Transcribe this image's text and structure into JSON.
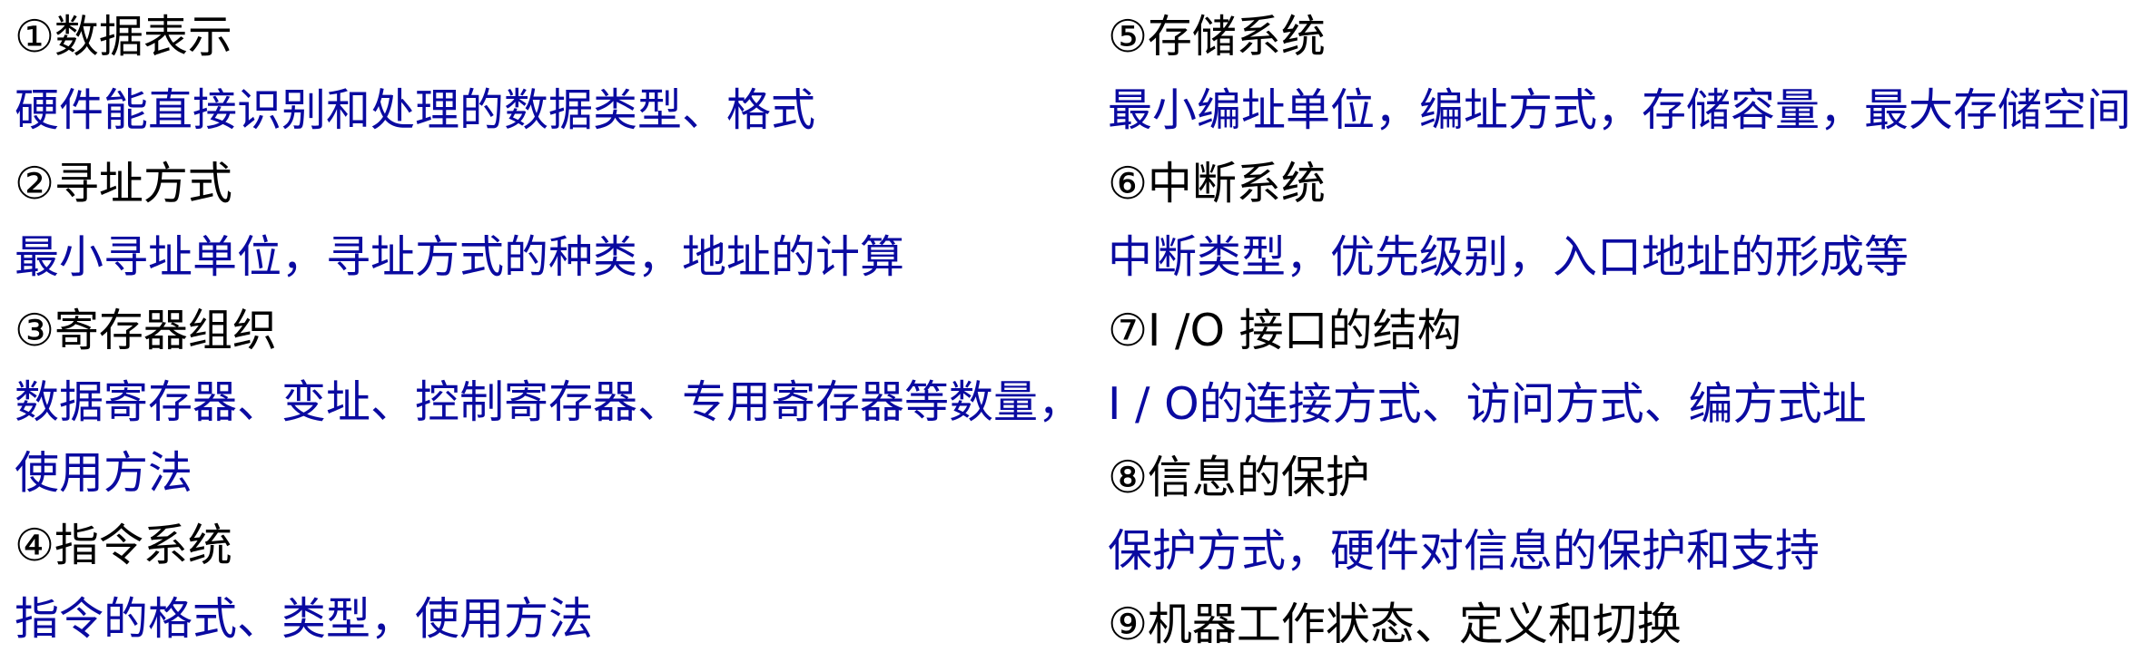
{
  "left": [
    {
      "heading": "①数据表示",
      "desc": "硬件能直接识别和处理的数据类型、格式"
    },
    {
      "heading": "②寻址方式",
      "desc": "最小寻址单位，寻址方式的种类，地址的计算"
    },
    {
      "heading": "③寄存器组织",
      "desc": "数据寄存器、变址、控制寄存器、专用寄存器等数量，使用方法"
    },
    {
      "heading": "④指令系统",
      "desc": "指令的格式、类型，使用方法"
    }
  ],
  "right": [
    {
      "heading": "⑤存储系统",
      "desc": "最小编址单位，编址方式，存储容量，最大存储空间"
    },
    {
      "heading": "⑥中断系统",
      "desc": "中断类型，优先级别，入口地址的形成等"
    },
    {
      "heading": "⑦I /O 接口的结构",
      "desc": "I / O的连接方式、访问方式、编方式址"
    },
    {
      "heading": "⑧信息的保护",
      "desc": "保护方式，硬件对信息的保护和支持"
    },
    {
      "heading": "⑨机器工作状态、定义和切换"
    }
  ],
  "colors": {
    "heading": "#000000",
    "desc": "#0a0aa0"
  }
}
